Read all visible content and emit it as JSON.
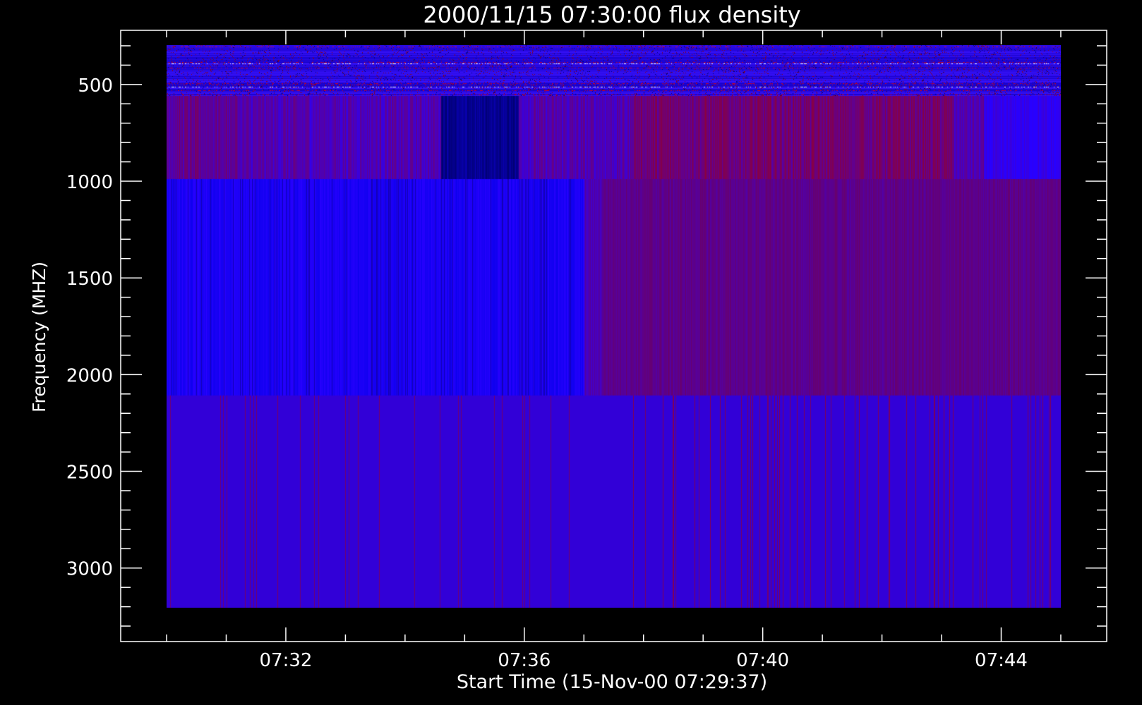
{
  "chart_data": {
    "type": "heatmap",
    "title": "2000/11/15 07:30:00 flux density",
    "xlabel": "Start Time (15-Nov-00 07:29:37)",
    "ylabel": "Frequency (MHZ)",
    "x_tick_labels": [
      "07:32",
      "07:36",
      "07:40",
      "07:44"
    ],
    "x_tick_minutes": [
      32,
      36,
      40,
      44
    ],
    "x_minor_tick_minutes": [
      30,
      31,
      32,
      33,
      34,
      35,
      36,
      37,
      38,
      39,
      40,
      41,
      42,
      43,
      44,
      45
    ],
    "x_range_minutes": [
      29.23,
      45.77
    ],
    "data_x_range_minutes": [
      30.0,
      45.0
    ],
    "y_tick_labels": [
      "500",
      "1000",
      "1500",
      "2000",
      "2500",
      "3000"
    ],
    "y_tick_values": [
      500,
      1000,
      1500,
      2000,
      2500,
      3000
    ],
    "y_minor_step": 100,
    "y_range": [
      220,
      3380
    ],
    "y_inverted": true,
    "frequency_bands": [
      {
        "from": 295,
        "to": 555,
        "character": "noisy dark blue with red and white speckles"
      },
      {
        "from": 555,
        "to": 985,
        "character": "blue-to-dark-red striations, dark dip near 07:35, brighter red 07:38-07:43"
      },
      {
        "from": 985,
        "to": 2105,
        "character": "blue until ~07:37, dark red after"
      },
      {
        "from": 2105,
        "to": 3205,
        "character": "uniform violet-blue with sparse red lines"
      }
    ],
    "colors": {
      "background": "#000000",
      "axes": "#ffffff",
      "low": "#1a00ff",
      "high": "#8a0000"
    },
    "grid": false
  }
}
